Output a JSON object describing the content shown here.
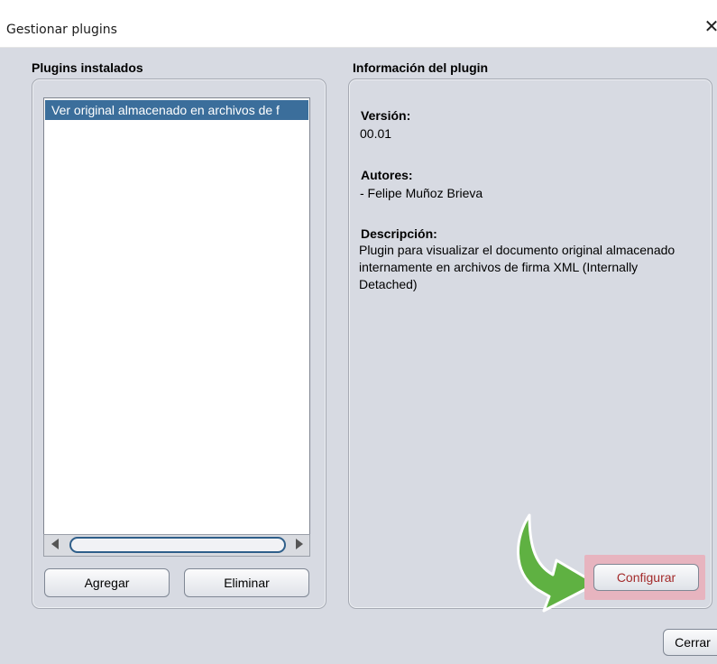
{
  "window": {
    "title": "Gestionar plugins",
    "close_icon": "close-icon"
  },
  "installed_plugins": {
    "title": "Plugins instalados",
    "items": [
      "Ver original almacenado en archivos de f"
    ],
    "buttons": {
      "add": "Agregar",
      "remove": "Eliminar"
    }
  },
  "plugin_info": {
    "title": "Información del plugin",
    "version_label": "Versión:",
    "version_value": "00.01",
    "authors_label": "Autores:",
    "authors_value": "- Felipe Muñoz Brieva",
    "description_label": "Descripción:",
    "description_value": "Plugin para visualizar el documento original almacenado internamente en archivos de firma XML (Internally Detached)",
    "configure_button": "Configurar"
  },
  "footer": {
    "close_button": "Cerrar"
  },
  "colors": {
    "selection": "#3b6e9b",
    "highlight": "#e7b4bf",
    "arrow": "#5fb142",
    "configure_text": "#a32b2b"
  }
}
